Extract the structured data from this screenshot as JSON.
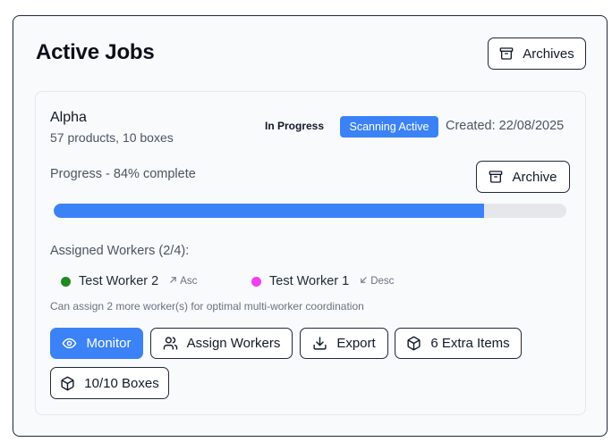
{
  "header": {
    "title": "Active Jobs",
    "archives_label": "Archives"
  },
  "job": {
    "name": "Alpha",
    "meta": "57 products, 10 boxes",
    "status": "In Progress",
    "scanning_badge": "Scanning Active",
    "created": "Created: 22/08/2025",
    "progress_label": "Progress - 84% complete",
    "progress_fraction": 0.84,
    "archive_label": "Archive",
    "workers_label": "Assigned Workers (2/4):",
    "workers": [
      {
        "name": "Test Worker 2",
        "sort": "Asc",
        "dot_color": "#1f8a1f",
        "sort_icon": "arrow-up-right-icon"
      },
      {
        "name": "Test Worker 1",
        "sort": "Desc",
        "dot_color": "#f03ef0",
        "sort_icon": "arrow-down-left-icon"
      }
    ],
    "hint": "Can assign 2 more worker(s) for optimal multi-worker coordination",
    "actions": {
      "monitor": "Monitor",
      "assign": "Assign Workers",
      "export": "Export",
      "extra_items": "6 Extra Items",
      "boxes": "10/10 Boxes"
    }
  },
  "colors": {
    "accent": "#3b82f6",
    "track": "#e5e7eb",
    "border": "#1f2937"
  }
}
